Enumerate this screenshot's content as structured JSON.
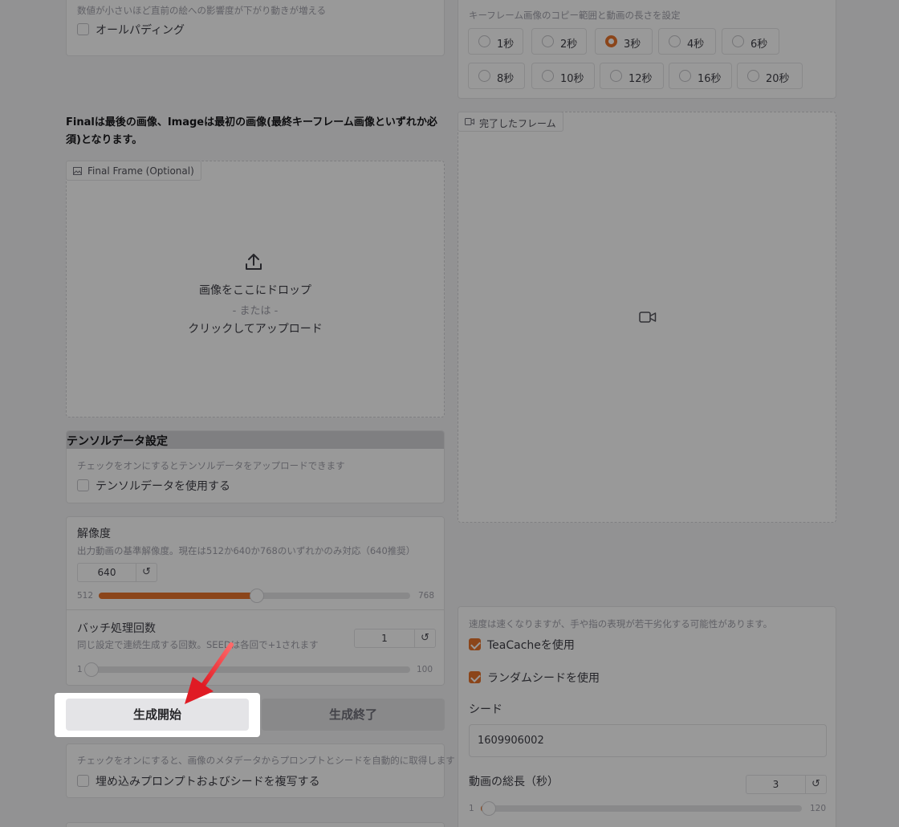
{
  "left": {
    "top_panel": {
      "info": "数値が小さいほど直前の絵への影響度が下がり動きが増える",
      "checkbox_label": "オールパディング"
    },
    "final_description": "Finalは最後の画像、Imageは最初の画像(最終キーフレーム画像といずれか必須)となります。",
    "final_frame": {
      "tag": "Final Frame (Optional)",
      "drop_line1": "画像をここにドロップ",
      "drop_line2": "- または -",
      "drop_line3": "クリックしてアップロード"
    },
    "tensor": {
      "title": "テンソルデータ設定",
      "info": "チェックをオンにするとテンソルデータをアップロードできます",
      "checkbox_label": "テンソルデータを使用する"
    },
    "resolution": {
      "label": "解像度",
      "info": "出力動画の基準解像度。現在は512か640か768のいずれかのみ対応（640推奨）",
      "value": "640",
      "min": "512",
      "max": "768",
      "fraction": 0.5
    },
    "batch": {
      "label": "バッチ処理回数",
      "info": "同じ設定で連続生成する回数。SEEDは各回で+1されます",
      "value": "1",
      "min": "1",
      "max": "100",
      "fraction": 0.0
    },
    "buttons": {
      "start": "生成開始",
      "stop": "生成終了"
    },
    "metadata": {
      "info": "チェックをオンにすると、画像のメタデータからプロンプトとシードを自動的に取得します",
      "checkbox_label": "埋め込みプロンプトおよびシードを複写する"
    }
  },
  "right": {
    "duration": {
      "info": "キーフレーム画像のコピー範囲と動画の長さを設定",
      "options": [
        "1秒",
        "2秒",
        "3秒",
        "4秒",
        "6秒",
        "8秒",
        "10秒",
        "12秒",
        "16秒",
        "20秒"
      ],
      "selected": "3秒"
    },
    "completed_frame": {
      "tag": "完了したフレーム"
    },
    "settings": {
      "info": "速度は速くなりますが、手や指の表現が若干劣化する可能性があります。",
      "teacache_label": "TeaCacheを使用",
      "random_seed_label": "ランダムシードを使用",
      "seed_label": "シード",
      "seed_value": "1609906002",
      "length_label": "動画の総長（秒）",
      "length_value": "3",
      "length_min": "1",
      "length_max": "120",
      "length_fraction": 0.017
    }
  },
  "reset_symbol": "↺",
  "colors": {
    "accent": "#e8742c",
    "annotation_arrow": "#e01b24"
  }
}
